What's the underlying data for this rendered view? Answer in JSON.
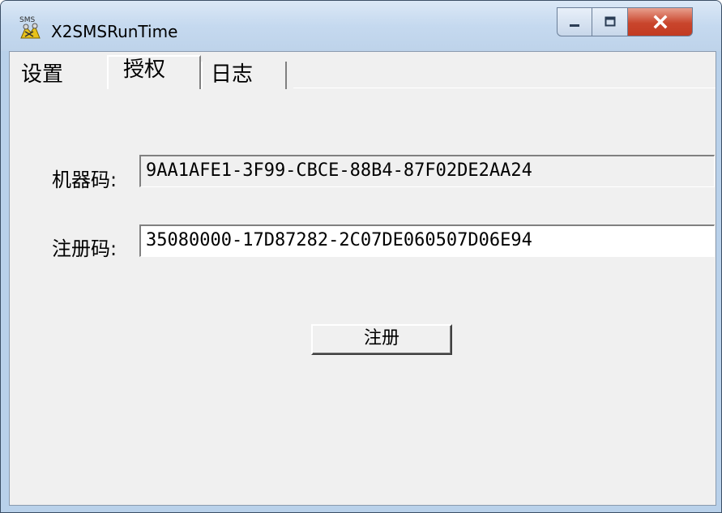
{
  "window": {
    "title": "X2SMSRunTime",
    "app_icon": "sms-app-icon",
    "controls": {
      "minimize": "minimize-icon",
      "maximize": "maximize-icon",
      "close": "close-icon"
    }
  },
  "tabs": [
    {
      "label": "设置",
      "selected": false
    },
    {
      "label": "授权",
      "selected": true
    },
    {
      "label": "日志",
      "selected": false
    }
  ],
  "form": {
    "machine_code_label": "机器码:",
    "machine_code_value": "9AA1AFE1-3F99-CBCE-88B4-87F02DE2AA24",
    "reg_code_label": "注册码:",
    "reg_code_value": "35080000-17D87282-2C07DE060507D06E94",
    "register_button": "注册"
  },
  "colors": {
    "face": "#f0f0f0",
    "frame": "#b9d1ea",
    "close_button": "#c9452c"
  }
}
